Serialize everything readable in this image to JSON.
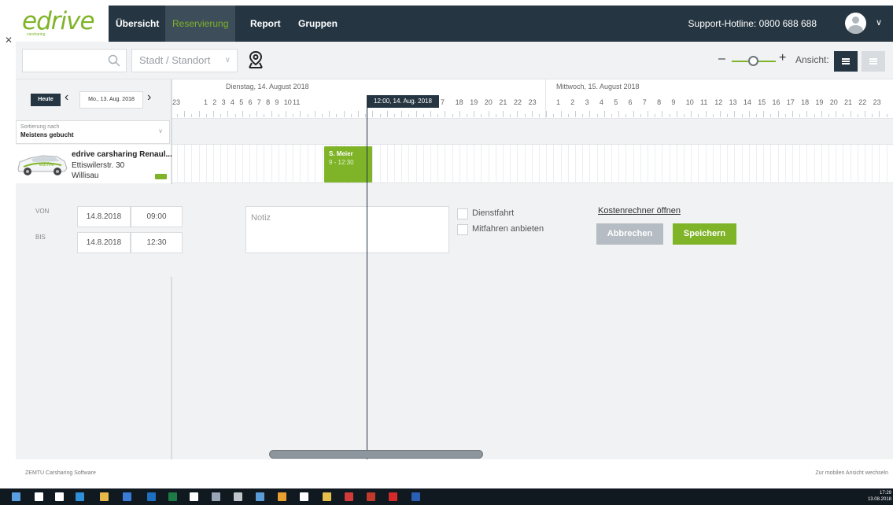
{
  "brand": {
    "logo": "edrive",
    "logo_sub": "carsharing"
  },
  "nav": {
    "items": [
      {
        "label": "Übersicht",
        "active": false
      },
      {
        "label": "Reservierung",
        "active": true
      },
      {
        "label": "Report",
        "active": false
      },
      {
        "label": "Gruppen",
        "active": false
      }
    ],
    "hotline": "Support-Hotline: 0800 688 688"
  },
  "toolbar": {
    "search": {
      "value": "",
      "placeholder": ""
    },
    "location_select": "Stadt / Standort",
    "view_label": "Ansicht:"
  },
  "date_nav": {
    "today_label": "Heute",
    "date": "Mo., 13. Aug. 2018"
  },
  "sort": {
    "label": "Sortierung nach",
    "value": "Meistens gebucht"
  },
  "timeline": {
    "days": [
      "Dienstag, 14. August 2018",
      "Mittwoch, 15. August 2018"
    ],
    "prev_hour": "23",
    "day1_hours": [
      "1",
      "2",
      "3",
      "4",
      "5",
      "6",
      "7",
      "8",
      "9",
      "10",
      "11"
    ],
    "day1_hours_after": [
      "7",
      "18",
      "19",
      "20",
      "21",
      "22",
      "23"
    ],
    "day2_hours": [
      "1",
      "2",
      "3",
      "4",
      "5",
      "6",
      "7",
      "8",
      "9",
      "10",
      "11",
      "12",
      "13",
      "14",
      "15",
      "16",
      "17",
      "18",
      "19",
      "20",
      "21",
      "22",
      "23"
    ],
    "now_label": "12:00, 14. Aug. 2018"
  },
  "vehicle": {
    "name": "edrive carsharing Renaul...",
    "street": "Ettiswilerstr. 30",
    "city": "Willisau",
    "car_logo": "edrive"
  },
  "booking": {
    "name": "S. Meier",
    "time": "9 - 12:30"
  },
  "form": {
    "from_label": "VON",
    "to_label": "BIS",
    "from_date": "14.8.2018",
    "from_time": "09:00",
    "to_date": "14.8.2018",
    "to_time": "12:30",
    "note_placeholder": "Notiz",
    "checkbox_business": "Dienstfahrt",
    "checkbox_share": "Mitfahren anbieten",
    "cost_link": "Kostenrechner öffnen",
    "cancel_label": "Abbrechen",
    "save_label": "Speichern"
  },
  "footer": {
    "left": "ZEMTU Carsharing Software",
    "right": "Zur mobilen Ansicht wechseln"
  },
  "taskbar": {
    "time": "17:29",
    "date": "13.08.2018"
  },
  "colors": {
    "accent": "#7fb428",
    "nav_bg": "#253642",
    "panel_bg": "#f1f2f4"
  }
}
